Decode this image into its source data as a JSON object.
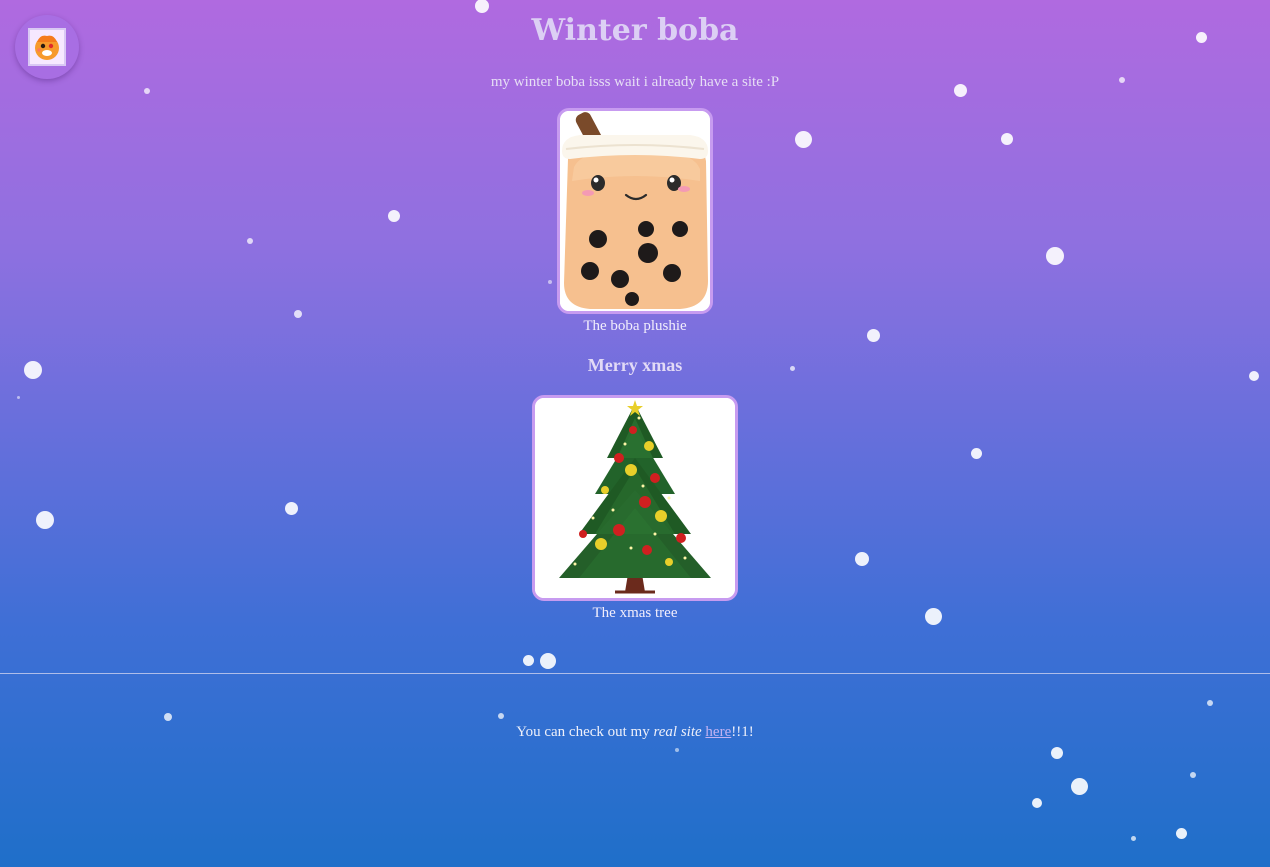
{
  "header": {
    "title": "Winter boba",
    "subtitle": "my winter boba isss wait i already have a site :P"
  },
  "avatar": {
    "icon": "orange-creature-icon"
  },
  "gallery": {
    "boba": {
      "caption": "The boba plushie",
      "image": "boba-plushie-image"
    },
    "section_heading": "Merry xmas",
    "tree": {
      "caption": "The xmas tree",
      "image": "christmas-tree-image"
    }
  },
  "footer": {
    "text_before": "You can check out my ",
    "emphasis": "real site",
    "space": " ",
    "link_label": "here",
    "text_after": "!!1!"
  },
  "colors": {
    "gradient_top": "#b06ae0",
    "gradient_bottom": "#1f6fc9",
    "card_border": "#c79bf0",
    "link": "#c3b3f2"
  }
}
